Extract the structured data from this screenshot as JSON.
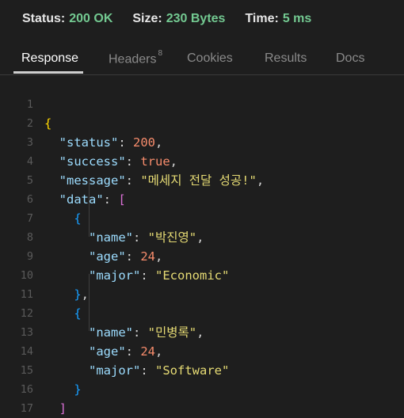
{
  "status_bar": {
    "status_label": "Status:",
    "status_value": "200 OK",
    "size_label": "Size:",
    "size_value": "230 Bytes",
    "time_label": "Time:",
    "time_value": "5 ms"
  },
  "tabs": [
    {
      "label": "Response",
      "active": true
    },
    {
      "label": "Headers",
      "badge": "8"
    },
    {
      "label": "Cookies"
    },
    {
      "label": "Results"
    },
    {
      "label": "Docs"
    }
  ],
  "code": {
    "line_numbers": [
      "1",
      "2",
      "3",
      "4",
      "5",
      "6",
      "7",
      "8",
      "9",
      "10",
      "11",
      "12",
      "13",
      "14",
      "15",
      "16",
      "17"
    ],
    "keys": {
      "status": "\"status\"",
      "success": "\"success\"",
      "message": "\"message\"",
      "data": "\"data\"",
      "name": "\"name\"",
      "age": "\"age\"",
      "major": "\"major\""
    },
    "values": {
      "status": "200",
      "success": "true",
      "message": "\"메세지 전달 성공!\"",
      "item1_name": "\"박진영\"",
      "item1_age": "24",
      "item1_major": "\"Economic\"",
      "item2_name": "\"민병록\"",
      "item2_age": "24",
      "item2_major": "\"Software\""
    }
  },
  "colors": {
    "background": "#1e1e1e",
    "status_green": "#73c991",
    "json_key": "#9cdcfe",
    "json_string": "#e6db74",
    "json_number": "#f78c6c"
  }
}
